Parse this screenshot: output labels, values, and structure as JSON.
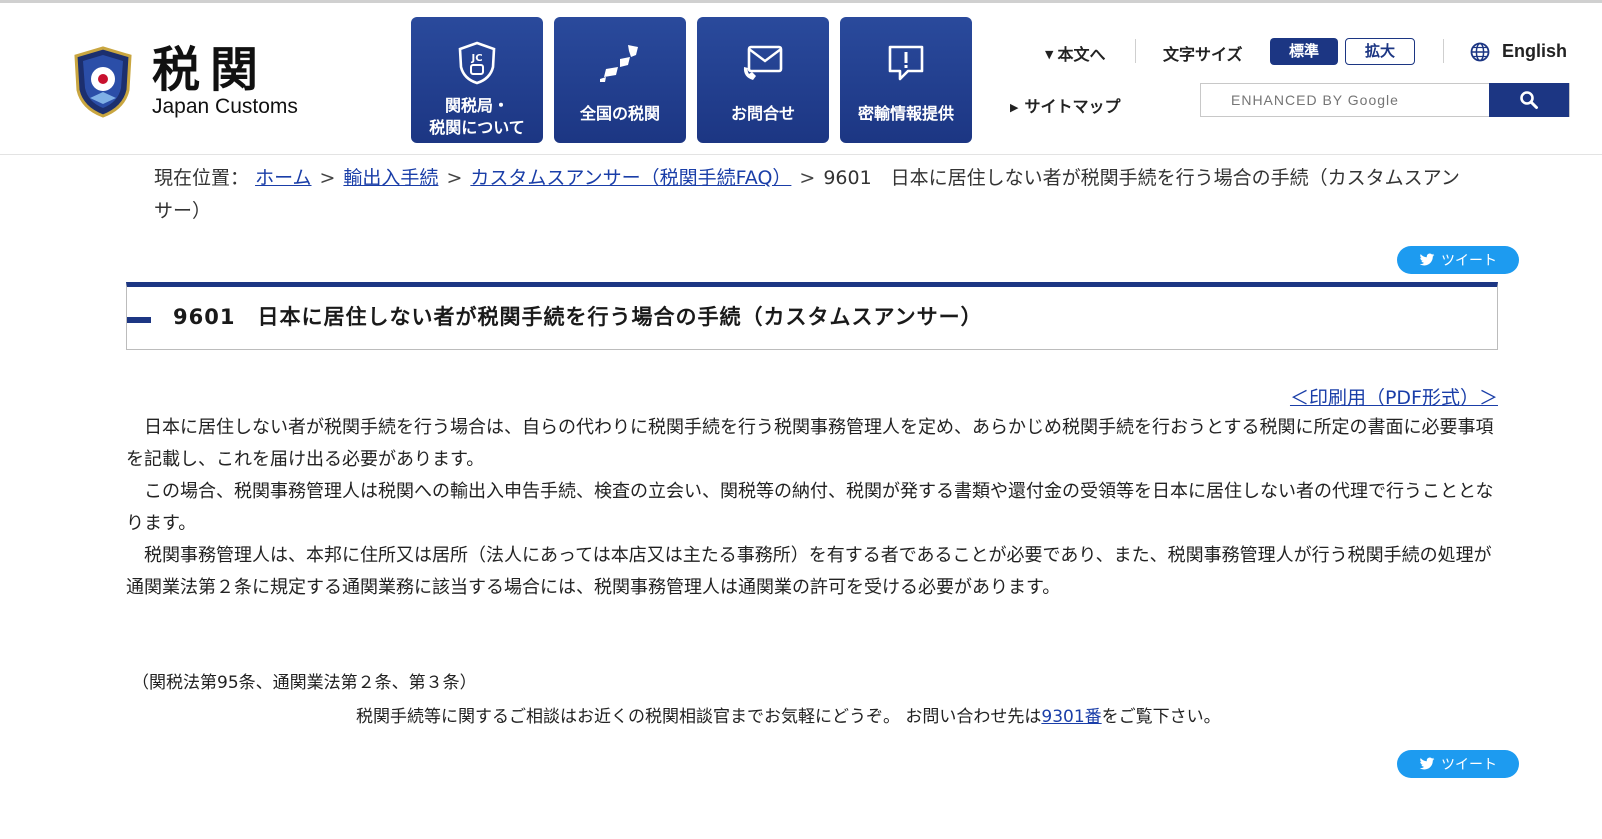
{
  "header": {
    "logo_kanji": "税関",
    "logo_en": "Japan Customs",
    "nav_buttons": [
      {
        "label": "関税局・\n税関について",
        "icon": "jc-badge-icon"
      },
      {
        "label": "全国の税関",
        "icon": "japan-map-icon"
      },
      {
        "label": "お問合せ",
        "icon": "mail-phone-icon"
      },
      {
        "label": "密輸情報提供",
        "icon": "alert-message-icon"
      }
    ],
    "utility": {
      "honbun": "本文へ",
      "font_size_label": "文字サイズ",
      "font_standard": "標準",
      "font_large": "拡大",
      "english": "English",
      "sitemap": "サイトマップ"
    },
    "search": {
      "placeholder": "ENHANCED BY Google"
    }
  },
  "breadcrumb": {
    "prefix": "現在位置：",
    "items": [
      "ホーム",
      "輸出入手続",
      "カスタムスアンサー（税関手続FAQ）"
    ],
    "current": "9601　日本に居住しない者が税関手続を行う場合の手続（カスタムスアンサー）"
  },
  "tweet_label": "ツイート",
  "article": {
    "title": "9601　日本に居住しない者が税関手続を行う場合の手続（カスタムスアンサー）",
    "pdf_link": "＜印刷用（PDF形式）＞",
    "paragraphs": [
      "日本に居住しない者が税関手続を行う場合は、自らの代わりに税関手続を行う税関事務管理人を定め、あらかじめ税関手続を行おうとする税関に所定の書面に必要事項を記載し、これを届け出る必要があります。",
      "この場合、税関事務管理人は税関への輸出入申告手続、検査の立会い、関税等の納付、税関が発する書類や還付金の受領等を日本に居住しない者の代理で行うこととなります。",
      "税関事務管理人は、本邦に住所又は居所（法人にあっては本店又は主たる事務所）を有する者であることが必要であり、また、税関事務管理人が行う税関手続の処理が通関業法第２条に規定する通関業務に該当する場合には、税関事務管理人は通関業の許可を受ける必要があります。"
    ],
    "law_ref": "（関税法第95条、通関業法第２条、第３条）",
    "consult_before": "税関手続等に関するご相談はお近くの税関相談官までお気軽にどうぞ。 お問い合わせ先は",
    "consult_link": "9301番",
    "consult_after": "をご覧下さい。"
  },
  "colors": {
    "brand_navy": "#1c3683",
    "link_blue": "#1a3ea8",
    "tweet_blue": "#1d9bf0"
  }
}
